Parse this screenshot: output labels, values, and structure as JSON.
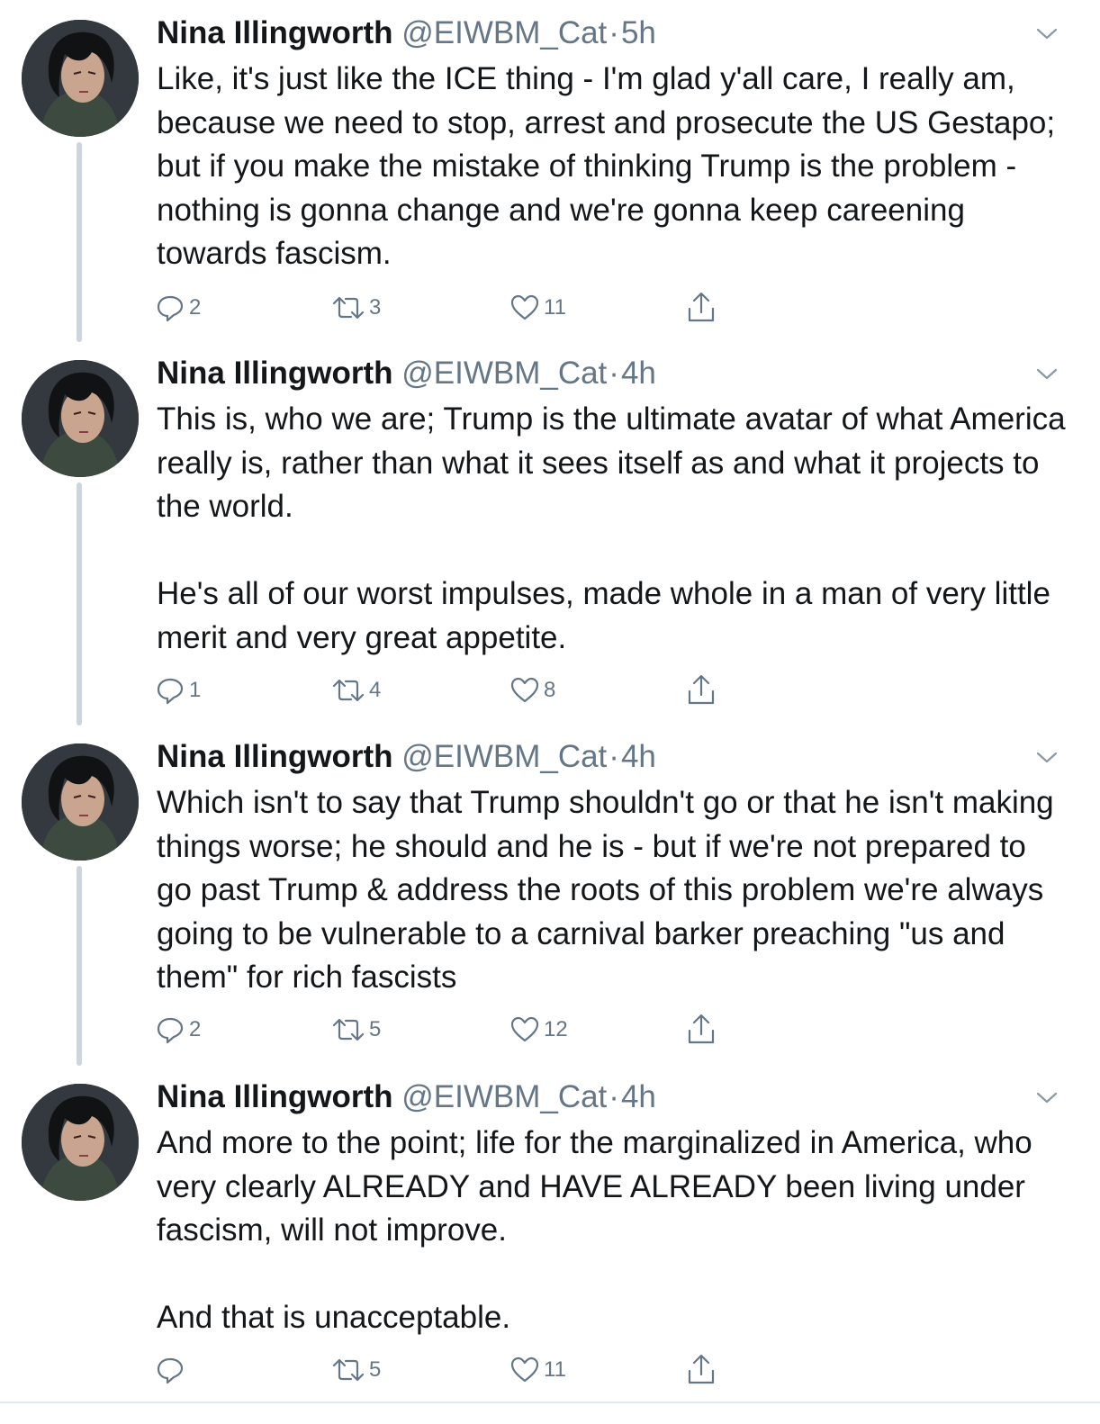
{
  "author": {
    "name": "Nina Illingworth",
    "handle": "@EIWBM_Cat",
    "separator": "·"
  },
  "tweets": [
    {
      "time": "5h",
      "paragraphs": [
        "Like, it's just like the ICE thing - I'm glad y'all care, I really am, because we need to stop, arrest and prosecute the US Gestapo; but if you make the mistake of thinking Trump is the problem - nothing is gonna change and we're gonna keep careening towards fascism."
      ],
      "replies": "2",
      "retweets": "3",
      "likes": "11"
    },
    {
      "time": "4h",
      "paragraphs": [
        "This is, who we are; Trump is the ultimate avatar of what America really is, rather than what it sees itself as and what it projects to the world.",
        "He's all of our worst impulses, made whole in a man of very little merit and very great appetite."
      ],
      "replies": "1",
      "retweets": "4",
      "likes": "8"
    },
    {
      "time": "4h",
      "paragraphs": [
        "Which isn't to say that Trump shouldn't go or that he isn't making things worse; he should and he is - but if we're not prepared to go past Trump & address the roots of this problem we're always going to be vulnerable to a carnival barker preaching \"us and them\" for rich fascists"
      ],
      "replies": "2",
      "retweets": "5",
      "likes": "12"
    },
    {
      "time": "4h",
      "paragraphs": [
        "And more to the point; life for the marginalized in America, who very clearly ALREADY and HAVE ALREADY been living under fascism, will not improve.",
        "And that is unacceptable."
      ],
      "replies": "",
      "retweets": "5",
      "likes": "11"
    }
  ],
  "icons": {
    "reply": "reply-icon",
    "retweet": "retweet-icon",
    "like": "heart-icon",
    "share": "share-icon",
    "menu": "chevron-down-icon"
  },
  "colors": {
    "text": "#14171a",
    "secondary": "#657786",
    "thread_line": "#cdd5de"
  }
}
